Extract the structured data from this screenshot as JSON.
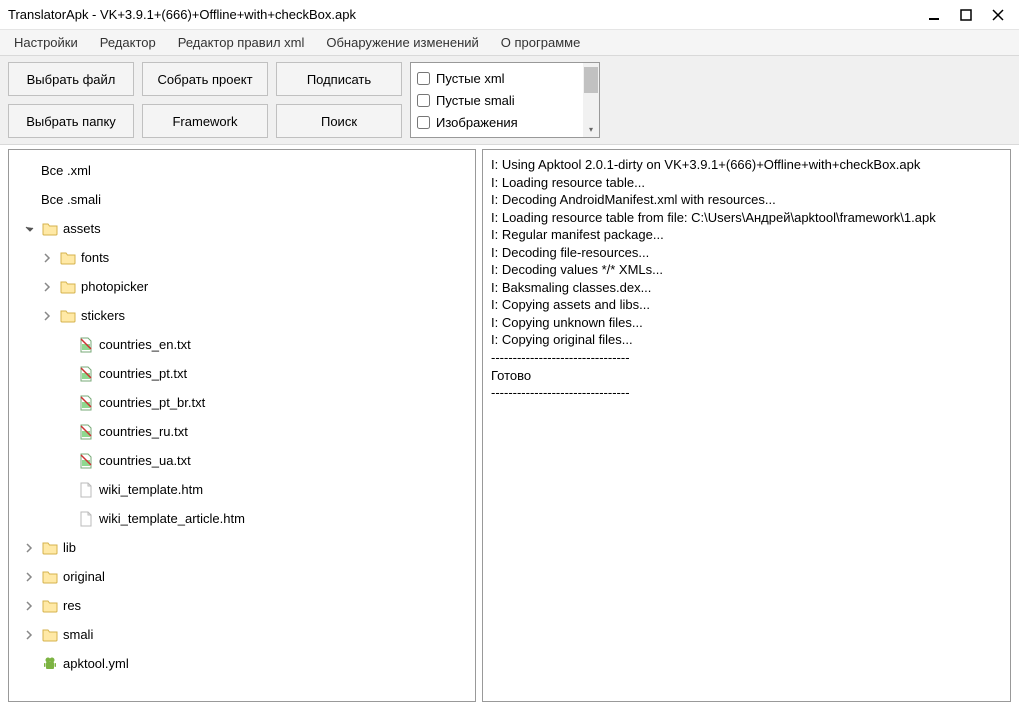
{
  "window": {
    "title": "TranslatorApk - VK+3.9.1+(666)+Offline+with+checkBox.apk"
  },
  "menu": {
    "items": [
      {
        "label": "Настройки"
      },
      {
        "label": "Редактор"
      },
      {
        "label": "Редактор правил xml"
      },
      {
        "label": "Обнаружение изменений"
      },
      {
        "label": "О программе"
      }
    ]
  },
  "toolbar": {
    "buttons": [
      {
        "label": "Выбрать файл"
      },
      {
        "label": "Собрать проект"
      },
      {
        "label": "Подписать"
      },
      {
        "label": "Выбрать папку"
      },
      {
        "label": "Framework"
      },
      {
        "label": "Поиск"
      }
    ],
    "filters": [
      {
        "label": "Пустые xml",
        "checked": false
      },
      {
        "label": "Пустые smali",
        "checked": false
      },
      {
        "label": "Изображения",
        "checked": false
      }
    ]
  },
  "tree": {
    "items": [
      {
        "label": "Все .xml",
        "indent": 0,
        "icon": "none",
        "expander": "none"
      },
      {
        "label": "Все .smali",
        "indent": 0,
        "icon": "none",
        "expander": "none"
      },
      {
        "label": "assets",
        "indent": 1,
        "icon": "folder",
        "expander": "open"
      },
      {
        "label": "fonts",
        "indent": 2,
        "icon": "folder",
        "expander": "closed"
      },
      {
        "label": "photopicker",
        "indent": 2,
        "icon": "folder",
        "expander": "closed"
      },
      {
        "label": "stickers",
        "indent": 2,
        "icon": "folder",
        "expander": "closed"
      },
      {
        "label": "countries_en.txt",
        "indent": 3,
        "icon": "txt-special",
        "expander": "none"
      },
      {
        "label": "countries_pt.txt",
        "indent": 3,
        "icon": "txt-special",
        "expander": "none"
      },
      {
        "label": "countries_pt_br.txt",
        "indent": 3,
        "icon": "txt-special",
        "expander": "none"
      },
      {
        "label": "countries_ru.txt",
        "indent": 3,
        "icon": "txt-special",
        "expander": "none"
      },
      {
        "label": "countries_ua.txt",
        "indent": 3,
        "icon": "txt-special",
        "expander": "none"
      },
      {
        "label": "wiki_template.htm",
        "indent": 3,
        "icon": "file",
        "expander": "none"
      },
      {
        "label": "wiki_template_article.htm",
        "indent": 3,
        "icon": "file",
        "expander": "none"
      },
      {
        "label": "lib",
        "indent": 1,
        "icon": "folder",
        "expander": "closed"
      },
      {
        "label": "original",
        "indent": 1,
        "icon": "folder",
        "expander": "closed"
      },
      {
        "label": "res",
        "indent": 1,
        "icon": "folder",
        "expander": "closed"
      },
      {
        "label": "smali",
        "indent": 1,
        "icon": "folder",
        "expander": "closed"
      },
      {
        "label": "apktool.yml",
        "indent": 1,
        "icon": "android",
        "expander": "leaf"
      }
    ]
  },
  "log": {
    "lines": [
      "I: Using Apktool 2.0.1-dirty on VK+3.9.1+(666)+Offline+with+checkBox.apk",
      "I: Loading resource table...",
      "I: Decoding AndroidManifest.xml with resources...",
      "I: Loading resource table from file: C:\\Users\\Андрей\\apktool\\framework\\1.apk",
      "I: Regular manifest package...",
      "I: Decoding file-resources...",
      "I: Decoding values */* XMLs...",
      "I: Baksmaling classes.dex...",
      "I: Copying assets and libs...",
      "I: Copying unknown files...",
      "I: Copying original files...",
      "--------------------------------",
      "Готово",
      "--------------------------------"
    ]
  }
}
